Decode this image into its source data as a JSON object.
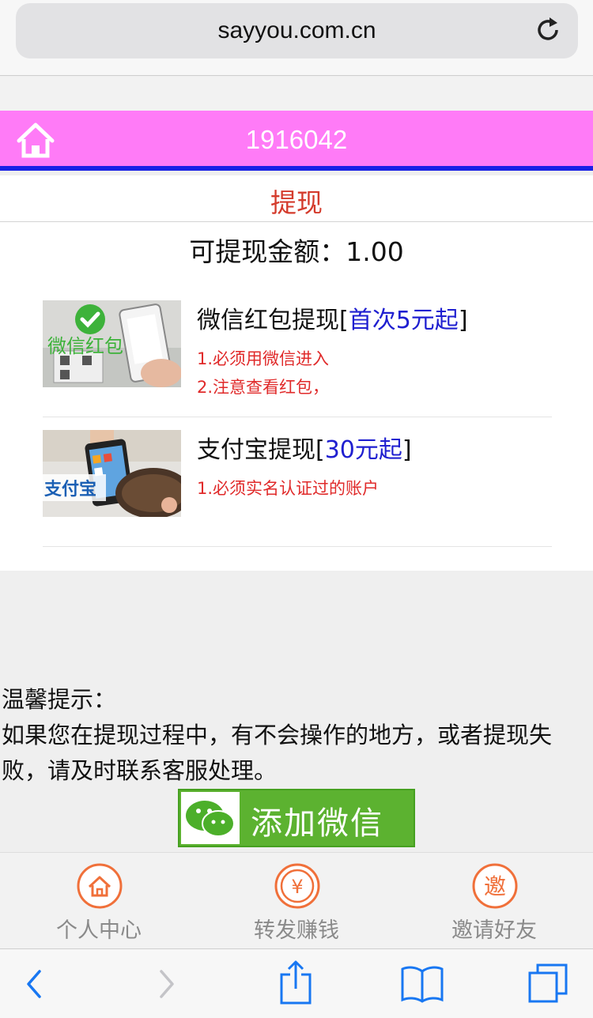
{
  "browser": {
    "url": "sayyou.com.cn"
  },
  "header": {
    "title": "1916042"
  },
  "page": {
    "section_title": "提现",
    "amount_text": "可提现金额：1.00"
  },
  "options": [
    {
      "title": "微信红包提现",
      "bracket_open": "[",
      "highlight": "首次5元起",
      "bracket_close": "]",
      "thumb_text": "微信红包",
      "notes": [
        "1.必须用微信进入",
        "2.注意查看红包，"
      ]
    },
    {
      "title": "支付宝提现",
      "bracket_open": "[",
      "highlight": "30元起",
      "bracket_close": "]",
      "thumb_text": "支付宝",
      "notes": [
        "1.必须实名认证过的账户"
      ]
    }
  ],
  "tips": {
    "label": "温馨提示：",
    "body": "如果您在提现过程中，有不会操作的地方，或者提现失败，请及时联系客服处理。"
  },
  "wechat_button": {
    "label": "添加微信"
  },
  "tabbar": {
    "items": [
      {
        "label": "个人中心",
        "icon": "home-icon"
      },
      {
        "label": "转发赚钱",
        "icon": "yen-icon",
        "glyph": "¥"
      },
      {
        "label": "邀请好友",
        "icon": "invite-icon",
        "glyph": "邀"
      }
    ]
  },
  "colors": {
    "header_bg": "#ff7bf7",
    "header_border": "#1a21e6",
    "section_title": "#d43b2c",
    "highlight": "#1f1fd0",
    "note": "#e02a2a",
    "tab_icon": "#f0703a",
    "wechat_green": "#5cb230"
  }
}
